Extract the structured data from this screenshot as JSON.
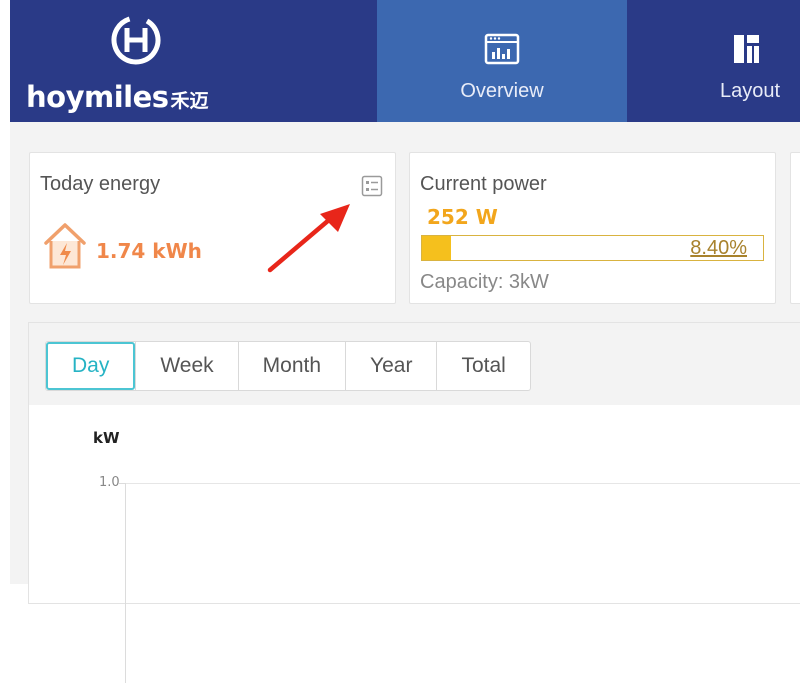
{
  "header": {
    "logo_text": "hoymiles",
    "logo_cn": "禾迈",
    "tabs": [
      {
        "label": "Overview",
        "icon": "chart-window-icon",
        "active": true
      },
      {
        "label": "Layout",
        "icon": "layout-grid-icon",
        "active": false
      }
    ]
  },
  "cards": {
    "today": {
      "title": "Today energy",
      "value": "1.74 kWh",
      "icon": "solar-house-icon",
      "detail_icon": "list-detail-icon"
    },
    "power": {
      "title": "Current power",
      "value": "252 W",
      "percent_text": "8.40%",
      "percent": 8.4,
      "capacity": "Capacity: 3kW"
    }
  },
  "chart": {
    "tabs": [
      "Day",
      "Week",
      "Month",
      "Year",
      "Total"
    ],
    "active_tab": "Day",
    "unit": "kW",
    "y_tick": "1.0"
  },
  "colors": {
    "header_bg": "#2a3a87",
    "active_tab_bg": "#3c68b0",
    "energy": "#f0874a",
    "power": "#f2a61c",
    "tab_accent": "#26b3c4",
    "arrow": "#e8261a"
  },
  "chart_data": {
    "type": "line",
    "ylabel": "kW",
    "yticks": [
      1.0
    ],
    "ylim": [
      0,
      1.0
    ],
    "series": []
  }
}
